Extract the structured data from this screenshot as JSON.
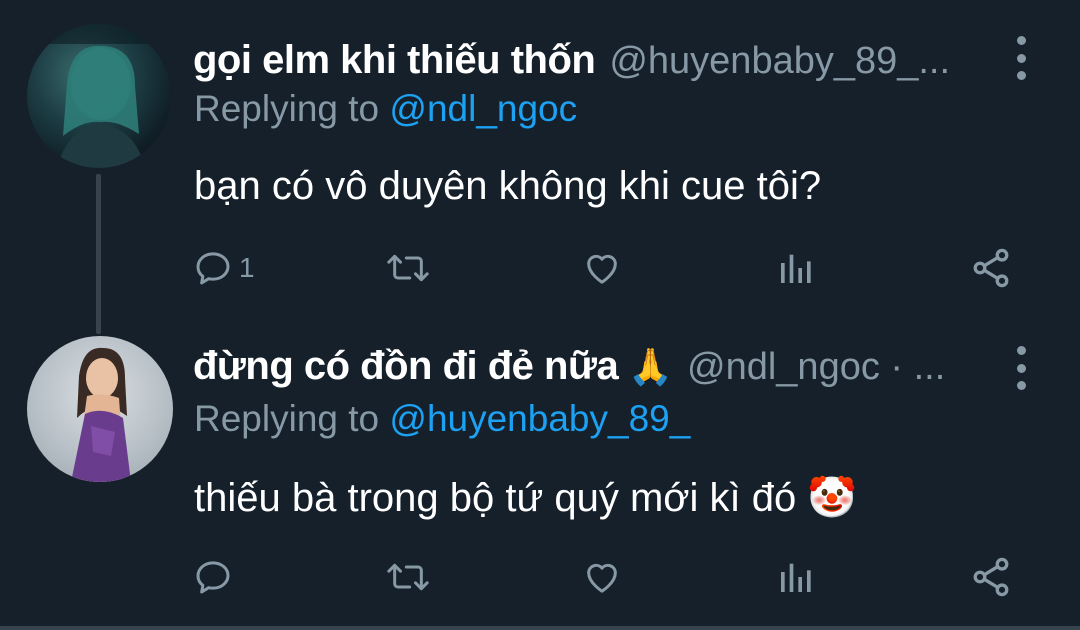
{
  "tweets": [
    {
      "display_name": "gọi elm khi thiếu thốn",
      "handle": "@huyenbaby_89_...",
      "replying_prefix": "Replying to",
      "replying_to": "@ndl_ngoc",
      "text": "bạn có vô duyên không khi cue tôi?",
      "reply_count": "1"
    },
    {
      "display_name": "đừng có đồn đi đẻ nữa",
      "name_emoji": "🙏",
      "handle": "@ndl_ngoc · ...",
      "replying_prefix": "Replying to",
      "replying_to": "@huyenbaby_89_",
      "text": "thiếu bà trong bộ tứ quý mới kì đó 🤡",
      "reply_count": ""
    }
  ],
  "colors": {
    "background": "#15202b",
    "muted": "#8899a6",
    "accent": "#1da1f2",
    "divider": "#38444d"
  },
  "icons": [
    "avatar",
    "more-vertical-icon",
    "reply-icon",
    "retweet-icon",
    "like-icon",
    "views-icon",
    "share-icon"
  ]
}
